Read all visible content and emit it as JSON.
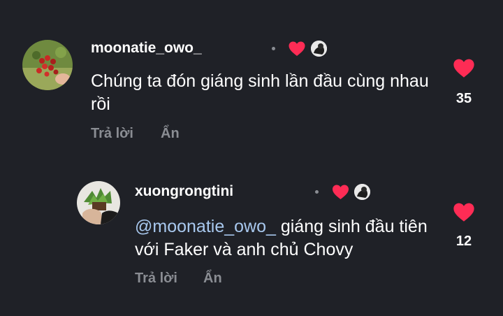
{
  "colors": {
    "background": "#1f2127",
    "heart": "#fe2c55",
    "muted": "#8a8d93",
    "mention": "#a8c8ee"
  },
  "comments": [
    {
      "username": "moonatie_owo_",
      "text": "Chúng ta đón giáng sinh lần đầu cùng nhau rồi",
      "reply_label": "Trả lời",
      "hide_label": "Ẩn",
      "like_count": "35",
      "liked_by_creator": true,
      "like_icon": "heart-icon"
    },
    {
      "username": "xuongrongtini",
      "mention": "@moonatie_owo_",
      "text": " giáng sinh đầu tiên với Faker và anh chủ Chovy",
      "reply_label": "Trả lời",
      "hide_label": "Ẩn",
      "like_count": "12",
      "liked_by_creator": true,
      "like_icon": "heart-icon"
    }
  ]
}
